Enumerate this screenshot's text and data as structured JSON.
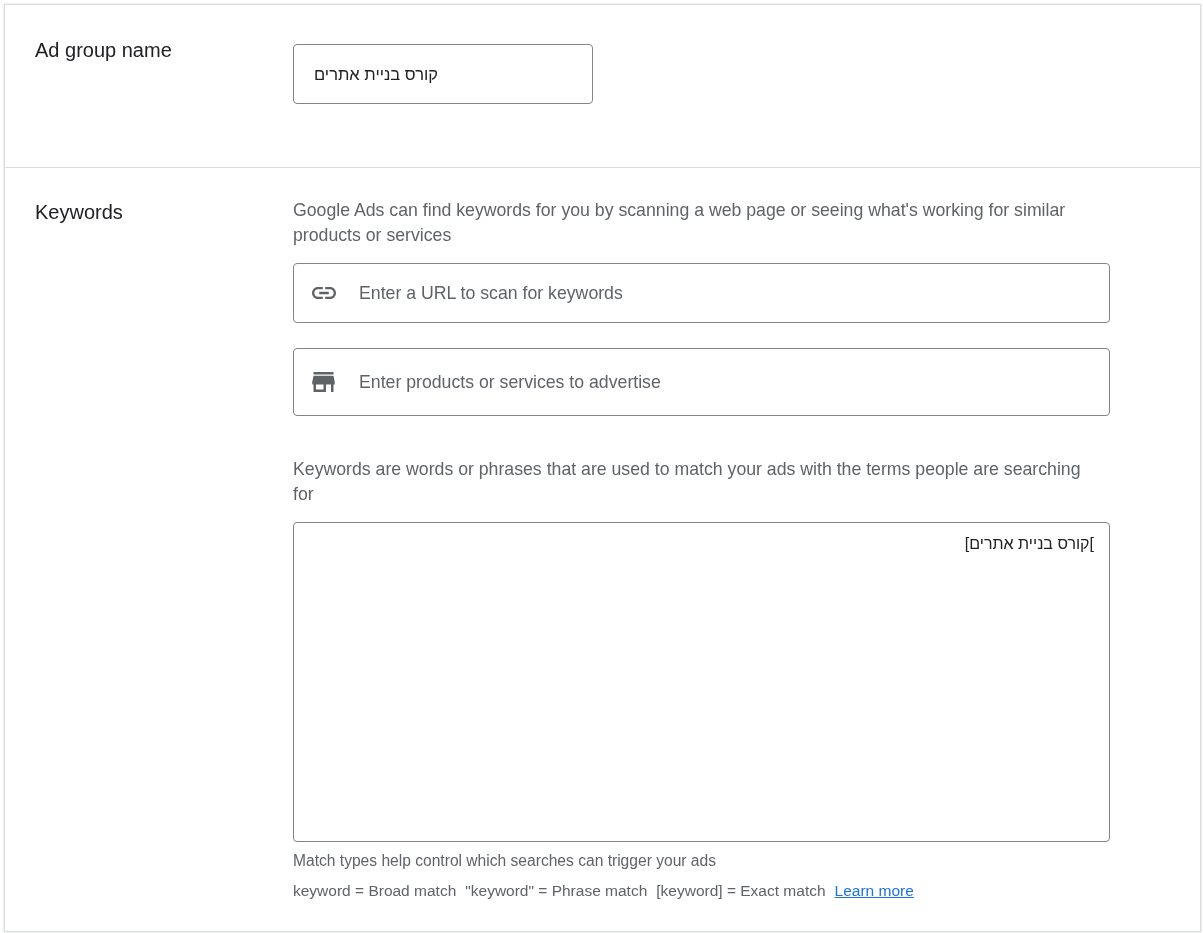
{
  "ad_group": {
    "label": "Ad group name",
    "name_input": {
      "value": "קורס בניית אתרים"
    }
  },
  "keywords": {
    "label": "Keywords",
    "description": "Google Ads can find keywords for you by scanning a web page or seeing what's working for similar products or services",
    "seed_fields": [
      {
        "kind": "url",
        "placeholder": "Enter a URL to scan for keywords"
      },
      {
        "kind": "products",
        "placeholder": "Enter products or services to advertise"
      }
    ],
    "keywords_description": "Keywords are words or phrases that are used to match your ads with the terms people are searching for",
    "keywords_input": {
      "value": "[קורס בניית אתרים["
    },
    "match_types_note": "Match types help control which searches can trigger your ads",
    "match_types": [
      "keyword = Broad match",
      "\"keyword\" = Phrase match",
      "[keyword] = Exact match"
    ],
    "learn_more_link": "Learn more"
  }
}
